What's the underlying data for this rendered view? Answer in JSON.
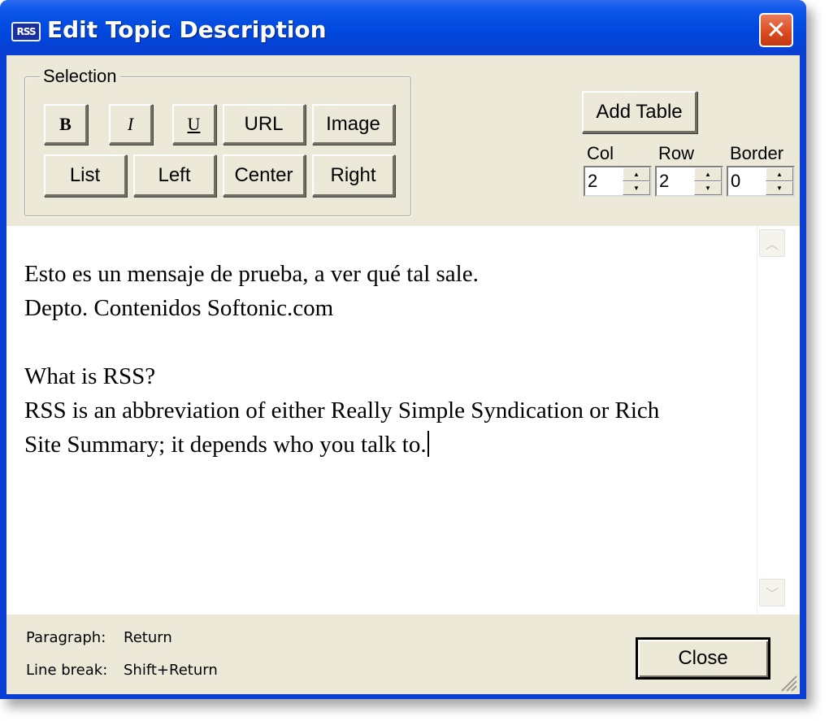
{
  "window": {
    "app_icon_label": "RSS",
    "title": "Edit Topic Description",
    "close_glyph": "✕"
  },
  "selection_group": {
    "label": "Selection",
    "row1": [
      {
        "label": "B",
        "name": "bold-button"
      },
      {
        "label": "I",
        "name": "italic-button"
      },
      {
        "label": "U",
        "name": "underline-button"
      },
      {
        "label": "URL",
        "name": "url-button"
      },
      {
        "label": "Image",
        "name": "image-button"
      }
    ],
    "row2": [
      {
        "label": "List",
        "name": "list-button"
      },
      {
        "label": "Left",
        "name": "align-left-button"
      },
      {
        "label": "Center",
        "name": "align-center-button"
      },
      {
        "label": "Right",
        "name": "align-right-button"
      }
    ]
  },
  "table": {
    "add_label": "Add Table",
    "col": {
      "label": "Col",
      "value": "2"
    },
    "row": {
      "label": "Row",
      "value": "2"
    },
    "border": {
      "label": "Border",
      "value": "0"
    }
  },
  "editor": {
    "lines": [
      "Esto es un mensaje de prueba, a ver qué tal sale.",
      "Depto. Contenidos Softonic.com",
      "",
      "What is RSS?",
      "RSS is an abbreviation of either Really Simple Syndication or Rich",
      "Site Summary; it depends who you talk to."
    ]
  },
  "scrollbar": {
    "up_glyph": "︿",
    "down_glyph": "﹀"
  },
  "hints": {
    "paragraph_label": "Paragraph:",
    "paragraph_value": "Return",
    "linebreak_label": "Line break:",
    "linebreak_value": "Shift+Return"
  },
  "footer": {
    "close_label": "Close"
  }
}
